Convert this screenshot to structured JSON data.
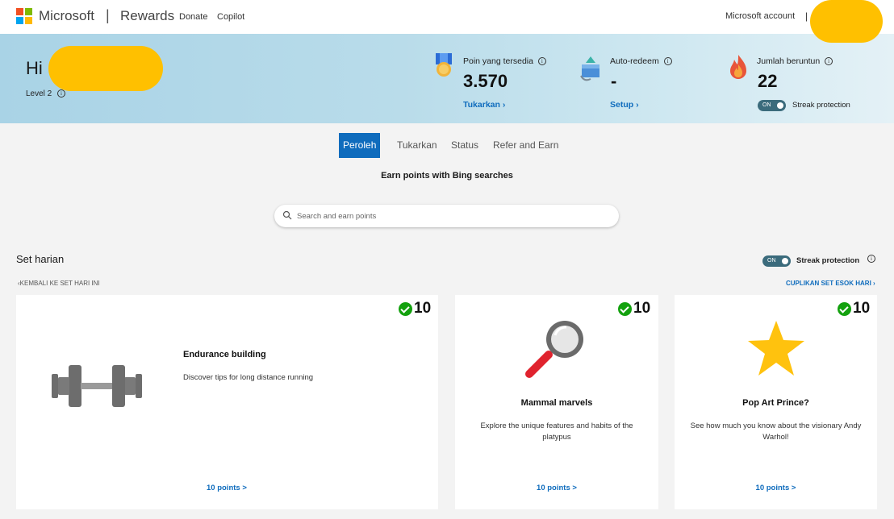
{
  "nav": {
    "brand": "Microsoft",
    "separator": "|",
    "product": "Rewards",
    "links": [
      "Donate",
      "Copilot"
    ],
    "account": "Microsoft account",
    "account_sep": "|"
  },
  "hero": {
    "greeting": "Hi",
    "level": "Level 2",
    "stats": [
      {
        "label": "Poin yang tersedia",
        "value": "3.570",
        "link": "Tukarkan ›"
      },
      {
        "label": "Auto-redeem",
        "value": "-",
        "link": "Setup ›"
      },
      {
        "label": "Jumlah beruntun",
        "value": "22",
        "toggle": "ON",
        "toggle_label": "Streak protection"
      }
    ]
  },
  "tabs": [
    "Peroleh",
    "Tukarkan",
    "Status",
    "Refer and Earn"
  ],
  "search": {
    "heading": "Earn points with Bing searches",
    "placeholder": "Search and earn points"
  },
  "daily_set": {
    "title": "Set harian",
    "toggle": "ON",
    "toggle_label": "Streak protection",
    "back_link": "KEMBALI KE SET HARI INI",
    "next_link": "CUPLIKAN SET ESOK HARI ›",
    "cards": [
      {
        "points": "10",
        "title": "Endurance building",
        "desc": "Discover tips for long distance running",
        "link": "10 points >",
        "icon": "dumbbell-icon"
      },
      {
        "points": "10",
        "title": "Mammal marvels",
        "desc": "Explore the unique features and habits of the platypus",
        "link": "10 points >",
        "icon": "magnifier-icon"
      },
      {
        "points": "10",
        "title": "Pop Art Prince?",
        "desc": "See how much you know about the visionary Andy Warhol!",
        "link": "10 points >",
        "icon": "star-icon"
      }
    ]
  },
  "colors": {
    "accent": "#0f6cbd",
    "check": "#13a10e",
    "redact": "#ffc000"
  }
}
